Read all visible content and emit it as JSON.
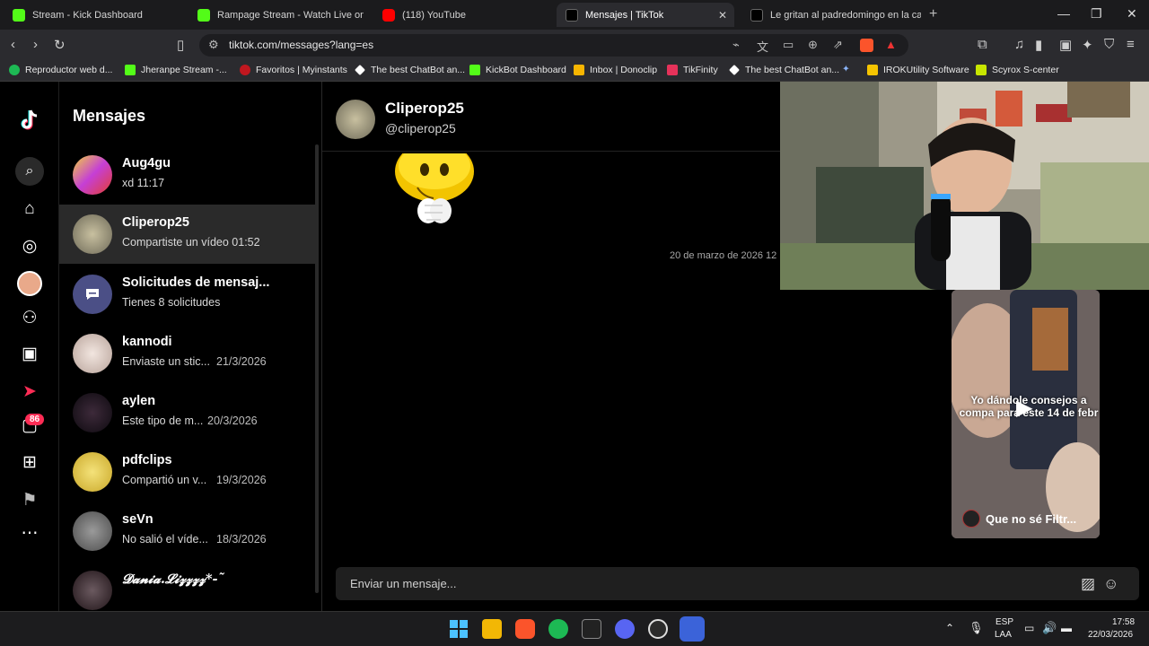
{
  "browser": {
    "tabs": [
      {
        "title": "Stream - Kick Dashboard",
        "color": "#53fc18"
      },
      {
        "title": "Rampage Stream - Watch Live on Kic",
        "color": "#53fc18"
      },
      {
        "title": "(118) YouTube",
        "color": "#ff0000"
      },
      {
        "title": "Mensajes | TikTok",
        "color": "#ffffff"
      },
      {
        "title": "Le gritan al padredomingo en la calle",
        "color": "#ffffff"
      }
    ],
    "active_tab_close": "✕",
    "new_tab": "+",
    "url": "tiktok.com/messages?lang=es",
    "bookmarks": [
      "Reproductor web d...",
      "Jheranpe Stream -...",
      "Favoritos | Myinstants",
      "The best ChatBot an...",
      "KickBot Dashboard",
      "Inbox | Donoclip",
      "TikFinity",
      "The best ChatBot an...",
      "IROKUtility Software",
      "Scyrox S-center"
    ]
  },
  "sidebar": {
    "notification_badge": "86"
  },
  "messages": {
    "title": "Mensajes",
    "conversations": [
      {
        "name": "Aug4gu",
        "preview": "xd 11:17",
        "time": ""
      },
      {
        "name": "Cliperop25",
        "preview": "Compartiste un vídeo 01:52",
        "time": ""
      },
      {
        "name": "Solicitudes de mensaj...",
        "preview": "Tienes 8 solicitudes",
        "time": ""
      },
      {
        "name": "kannodi",
        "preview": "Enviaste un stic...",
        "time": "21/3/2026"
      },
      {
        "name": "aylen",
        "preview": "Este tipo de m...",
        "time": "20/3/2026"
      },
      {
        "name": "pdfclips",
        "preview": "Compartió un v...",
        "time": "19/3/2026"
      },
      {
        "name": "seVn",
        "preview": "No salió el víde...",
        "time": "18/3/2026"
      },
      {
        "name": "𝓓𝓪𝓷𝓲𝓪.𝓛𝓲𝔃𝔃𝔃𝔃*-˜",
        "preview": "",
        "time": ""
      }
    ]
  },
  "chat": {
    "name": "Cliperop25",
    "handle": "@cliperop25",
    "date_separator": "20 de marzo de 2026 12",
    "input_placeholder": "Enviar un mensaje..."
  },
  "video_card": {
    "caption": "Yo dándole consejos a compa para este 14 de febr",
    "author": "Que no sé Filtr..."
  },
  "taskbar": {
    "lang_top": "ESP",
    "lang_bottom": "LAA",
    "time": "17:58",
    "date": "22/03/2026"
  }
}
